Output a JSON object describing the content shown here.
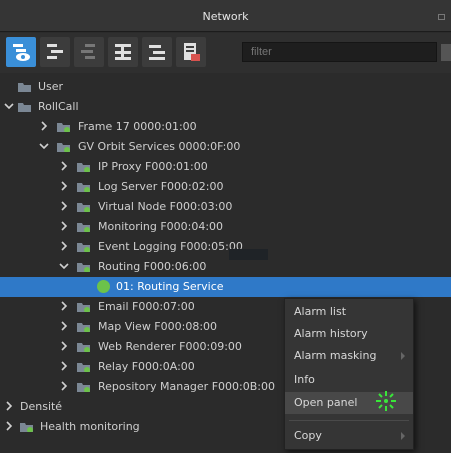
{
  "window": {
    "title": "Network"
  },
  "toolbar": {
    "buttons": [
      "tree-view-icon",
      "expand-tree-icon",
      "collapse-tree-icon",
      "expand-all-icon",
      "collapse-all-icon",
      "report-icon"
    ],
    "filter_placeholder": "filter",
    "accent": "#3a8fd8"
  },
  "tree": {
    "rows": [
      {
        "label": "User",
        "expanded": null,
        "icon": "folder-icon"
      },
      {
        "label": "RollCall",
        "expanded": true,
        "icon": "folder-icon"
      },
      {
        "label": "Frame 17 0000:01:00",
        "expanded": false,
        "icon": "device-icon"
      },
      {
        "label": "GV Orbit Services 0000:0F:00",
        "expanded": true,
        "icon": "device-icon"
      },
      {
        "label": "IP Proxy F000:01:00",
        "expanded": false,
        "icon": "device-icon"
      },
      {
        "label": "Log Server F000:02:00",
        "expanded": false,
        "icon": "device-icon"
      },
      {
        "label": "Virtual Node F000:03:00",
        "expanded": false,
        "icon": "device-icon"
      },
      {
        "label": "Monitoring F000:04:00",
        "expanded": false,
        "icon": "device-icon"
      },
      {
        "label": "Event Logging F000:05:00",
        "expanded": false,
        "icon": "device-icon"
      },
      {
        "label": "Routing F000:06:00",
        "expanded": true,
        "icon": "device-icon"
      },
      {
        "label": "01: Routing Service",
        "expanded": null,
        "icon": "status-ok-icon",
        "selected": true
      },
      {
        "label": "Email F000:07:00",
        "expanded": false,
        "icon": "device-icon"
      },
      {
        "label": "Map View F000:08:00",
        "expanded": false,
        "icon": "device-icon"
      },
      {
        "label": "Web Renderer F000:09:00",
        "expanded": false,
        "icon": "device-icon"
      },
      {
        "label": "Relay F000:0A:00",
        "expanded": false,
        "icon": "device-icon"
      },
      {
        "label": "Repository Manager F000:0B:00",
        "expanded": false,
        "icon": "device-icon"
      },
      {
        "label": "Densité",
        "expanded": false,
        "icon": null
      },
      {
        "label": "Health monitoring",
        "expanded": false,
        "icon": "device-icon"
      }
    ],
    "selected_color": "#2f79c8",
    "status_ok_color": "#6cc24a"
  },
  "context_menu": {
    "items": [
      {
        "label": "Alarm list",
        "submenu": false
      },
      {
        "label": "Alarm history",
        "submenu": false
      },
      {
        "label": "Alarm masking",
        "submenu": true
      },
      {
        "label": "Info",
        "submenu": false
      },
      {
        "label": "Open panel",
        "submenu": false,
        "highlighted": true
      },
      {
        "label": "Copy",
        "submenu": true
      }
    ]
  }
}
